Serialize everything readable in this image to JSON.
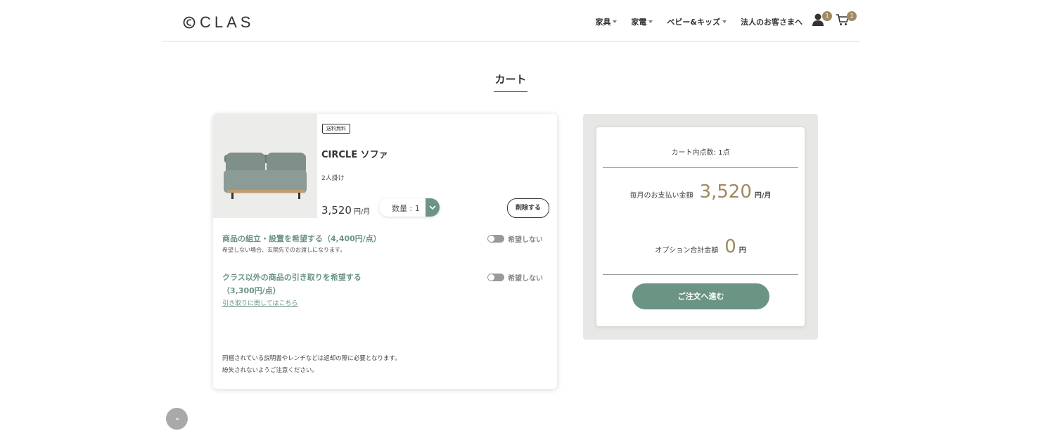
{
  "header": {
    "logo_text": "CLAS",
    "nav": [
      {
        "label": "家具"
      },
      {
        "label": "家電"
      },
      {
        "label": "ベビー&キッズ"
      },
      {
        "label": "法人のお客さまへ"
      }
    ],
    "user_badge": "1",
    "cart_badge": "1"
  },
  "page": {
    "title": "カート"
  },
  "cart_item": {
    "tag": "送料無料",
    "name": "CIRCLE ソファ",
    "variant": "2人掛け",
    "price": "3,520",
    "price_unit": "円/月",
    "quantity_label": "数量 : 1",
    "delete_label": "削除する",
    "options": [
      {
        "title": "商品の組立・設置を希望する（4,400円/点）",
        "note": "希望しない場合、玄関先でのお渡しになります。",
        "toggle_label": "希望しない"
      },
      {
        "title_line1": "クラス以外の商品の引き取りを希望する",
        "title_line2": "（3,300円/点）",
        "link": "引き取りに関してはこちら",
        "toggle_label": "希望しない"
      }
    ],
    "footnote_line1": "同梱されている説明書やレンチなどは返却の際に必要となります。",
    "footnote_line2": "紛失されないようご注意ください。"
  },
  "summary": {
    "count_label": "カート内点数: 1点",
    "monthly_label": "毎月のお支払い金額",
    "monthly_amount": "3,520",
    "monthly_unit": "円/月",
    "option_label": "オプション合計金額",
    "option_amount": "0",
    "option_unit": "円",
    "checkout_label": "ご注文へ進む"
  },
  "colors": {
    "accent_green": "#6b9484",
    "accent_gold": "#a08a62"
  }
}
